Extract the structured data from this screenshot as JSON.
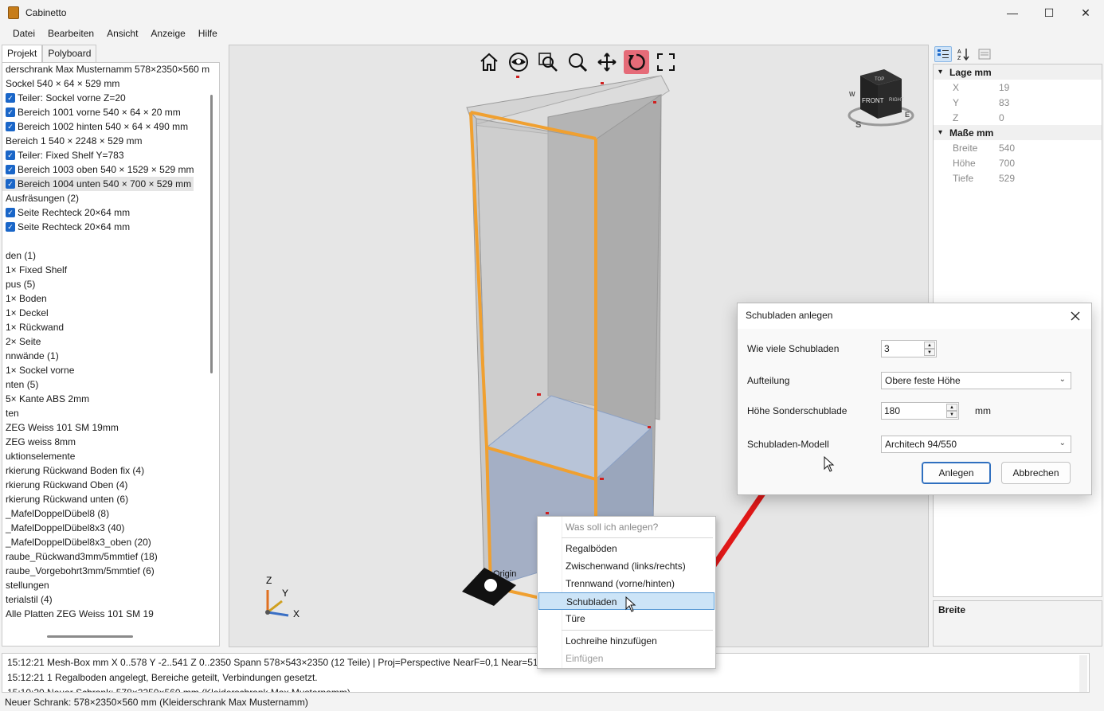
{
  "app": {
    "title": "Cabinetto"
  },
  "window_controls": {
    "minimize": "—",
    "maximize": "☐",
    "close": "✕"
  },
  "menu": [
    "Datei",
    "Bearbeiten",
    "Ansicht",
    "Anzeige",
    "Hilfe"
  ],
  "left_tabs": [
    "Projekt",
    "Polyboard"
  ],
  "tree": [
    {
      "text": "derschrank Max Musternamm  578×2350×560 m",
      "checked": false
    },
    {
      "text": "Sockel  540 × 64 × 529 mm",
      "checked": false
    },
    {
      "text": "Teiler: Sockel vorne  Z=20",
      "checked": true
    },
    {
      "text": "Bereich 1001  vorne  540 × 64 × 20 mm",
      "checked": true
    },
    {
      "text": "Bereich 1002  hinten  540 × 64 × 490 mm",
      "checked": true
    },
    {
      "text": "Bereich 1  540 × 2248 × 529 mm",
      "checked": false
    },
    {
      "text": "Teiler: Fixed Shelf  Y=783",
      "checked": true
    },
    {
      "text": "Bereich 1003  oben  540 × 1529 × 529 mm",
      "checked": true
    },
    {
      "text": "Bereich 1004  unten  540 × 700 × 529 mm",
      "checked": true,
      "selected": true
    },
    {
      "text": "Ausfräsungen  (2)",
      "checked": false
    },
    {
      "text": "Seite  Rechteck  20×64 mm",
      "checked": true
    },
    {
      "text": "Seite  Rechteck  20×64 mm",
      "checked": true
    },
    {
      "text": "",
      "checked": false
    },
    {
      "text": "den  (1)",
      "checked": false
    },
    {
      "text": "1×  Fixed Shelf",
      "checked": false
    },
    {
      "text": "pus  (5)",
      "checked": false
    },
    {
      "text": "1×  Boden",
      "checked": false
    },
    {
      "text": "1×  Deckel",
      "checked": false
    },
    {
      "text": "1×  Rückwand",
      "checked": false
    },
    {
      "text": "2×  Seite",
      "checked": false
    },
    {
      "text": "nnwände  (1)",
      "checked": false
    },
    {
      "text": "1×  Sockel vorne",
      "checked": false
    },
    {
      "text": "nten  (5)",
      "checked": false
    },
    {
      "text": "5×  Kante ABS 2mm",
      "checked": false
    },
    {
      "text": "ten",
      "checked": false
    },
    {
      "text": "ZEG Weiss 101 SM 19mm",
      "checked": false
    },
    {
      "text": "ZEG weiss 8mm",
      "checked": false
    },
    {
      "text": "uktionselemente",
      "checked": false
    },
    {
      "text": "rkierung Rückwand Boden fix  (4)",
      "checked": false
    },
    {
      "text": "rkierung Rückwand Oben  (4)",
      "checked": false
    },
    {
      "text": "rkierung Rückwand unten  (6)",
      "checked": false
    },
    {
      "text": "_MafelDoppelDübel8  (8)",
      "checked": false
    },
    {
      "text": "_MafelDoppelDübel8x3  (40)",
      "checked": false
    },
    {
      "text": "_MafelDoppelDübel8x3_oben  (20)",
      "checked": false
    },
    {
      "text": "raube_Rückwand3mm/5mmtief  (18)",
      "checked": false
    },
    {
      "text": "raube_Vorgebohrt3mm/5mmtief  (6)",
      "checked": false
    },
    {
      "text": "stellungen",
      "checked": false
    },
    {
      "text": "terialstil  (4)",
      "checked": false
    },
    {
      "text": "Alle Platten  ZEG Weiss 101 SM  19",
      "checked": false
    }
  ],
  "viewport": {
    "toolbar": [
      "home-icon",
      "eye-icon",
      "zoom-box-icon",
      "zoom-icon",
      "pan-icon",
      "rotate-icon",
      "fit-icon"
    ],
    "nav_cube": {
      "front": "FRONT",
      "top": "TOP",
      "right": "RIGHT",
      "south": "S",
      "east": "E",
      "west": "W"
    },
    "origin_label": "Origin",
    "axes": {
      "z": "Z",
      "y": "Y",
      "x": "X"
    },
    "accent": "#f0a030",
    "active_tool_color": "#e56b78"
  },
  "properties": {
    "groups": [
      {
        "title": "Lage mm",
        "rows": [
          {
            "key": "X",
            "value": "19"
          },
          {
            "key": "Y",
            "value": "83"
          },
          {
            "key": "Z",
            "value": "0"
          }
        ]
      },
      {
        "title": "Maße mm",
        "rows": [
          {
            "key": "Breite",
            "value": "540"
          },
          {
            "key": "Höhe",
            "value": "700"
          },
          {
            "key": "Tiefe",
            "value": "529"
          }
        ]
      }
    ],
    "description_title": "Breite"
  },
  "dialog": {
    "title": "Schubladen anlegen",
    "count_label": "Wie viele Schubladen",
    "count_value": "3",
    "split_label": "Aufteilung",
    "split_value": "Obere feste Höhe",
    "height_label": "Höhe Sonderschublade",
    "height_value": "180",
    "height_unit": "mm",
    "model_label": "Schubladen-Modell",
    "model_value": "Architech 94/550",
    "ok": "Anlegen",
    "cancel": "Abbrechen"
  },
  "context_menu": {
    "header": "Was soll ich anlegen?",
    "items": [
      "Regalböden",
      "Zwischenwand (links/rechts)",
      "Trennwand (vorne/hinten)",
      "Schubladen",
      "Türe"
    ],
    "extra": "Lochreihe hinzufügen",
    "disabled": "Einfügen",
    "highlighted": "Schubladen"
  },
  "log": [
    "15:12:21  Mesh-Box mm  X 0..578  Y -2..541  Z 0..2350  Spann 578×543×2350  (12 Teile)  |  Proj=Perspective  NearF=0,1  Near=51,",
    "15:12:21  1 Regalboden angelegt, Bereiche geteilt, Verbindungen gesetzt.",
    "15:10:20  Neuer Schrank: 578×2350×560 mm  (Kleiderschrank Max Musternamm)"
  ],
  "status": "Neuer Schrank: 578×2350×560 mm  (Kleiderschrank Max Musternamm)"
}
